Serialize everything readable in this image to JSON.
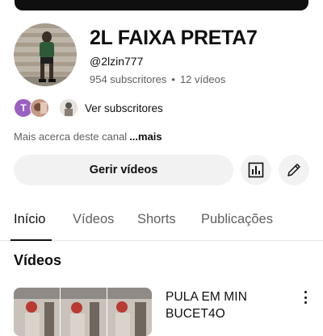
{
  "channel": {
    "name": "2L FAIXA PRETA7",
    "handle": "@2lzin777",
    "subscribers": "954 subscritores",
    "videos": "12 vídeos",
    "separator": "•"
  },
  "subscribers_row": {
    "first_avatar_letter": "T",
    "label": "Ver subscritores"
  },
  "about": {
    "text": "Mais acerca deste canal",
    "more": "...mais"
  },
  "actions": {
    "manage_videos": "Gerir vídeos",
    "analytics_icon": "bar-chart-icon",
    "edit_icon": "pencil-icon"
  },
  "tabs": [
    {
      "label": "Início",
      "active": true
    },
    {
      "label": "Vídeos",
      "active": false
    },
    {
      "label": "Shorts",
      "active": false
    },
    {
      "label": "Publicações",
      "active": false
    }
  ],
  "section": {
    "title": "Vídeos"
  },
  "videos": [
    {
      "title": "PULA EM MIN BUCET4O"
    }
  ],
  "colors": {
    "text_primary": "#0f0f0f",
    "text_secondary": "#606060",
    "button_bg": "#f2f2f2",
    "avatar_purple": "#9c5fc4"
  }
}
